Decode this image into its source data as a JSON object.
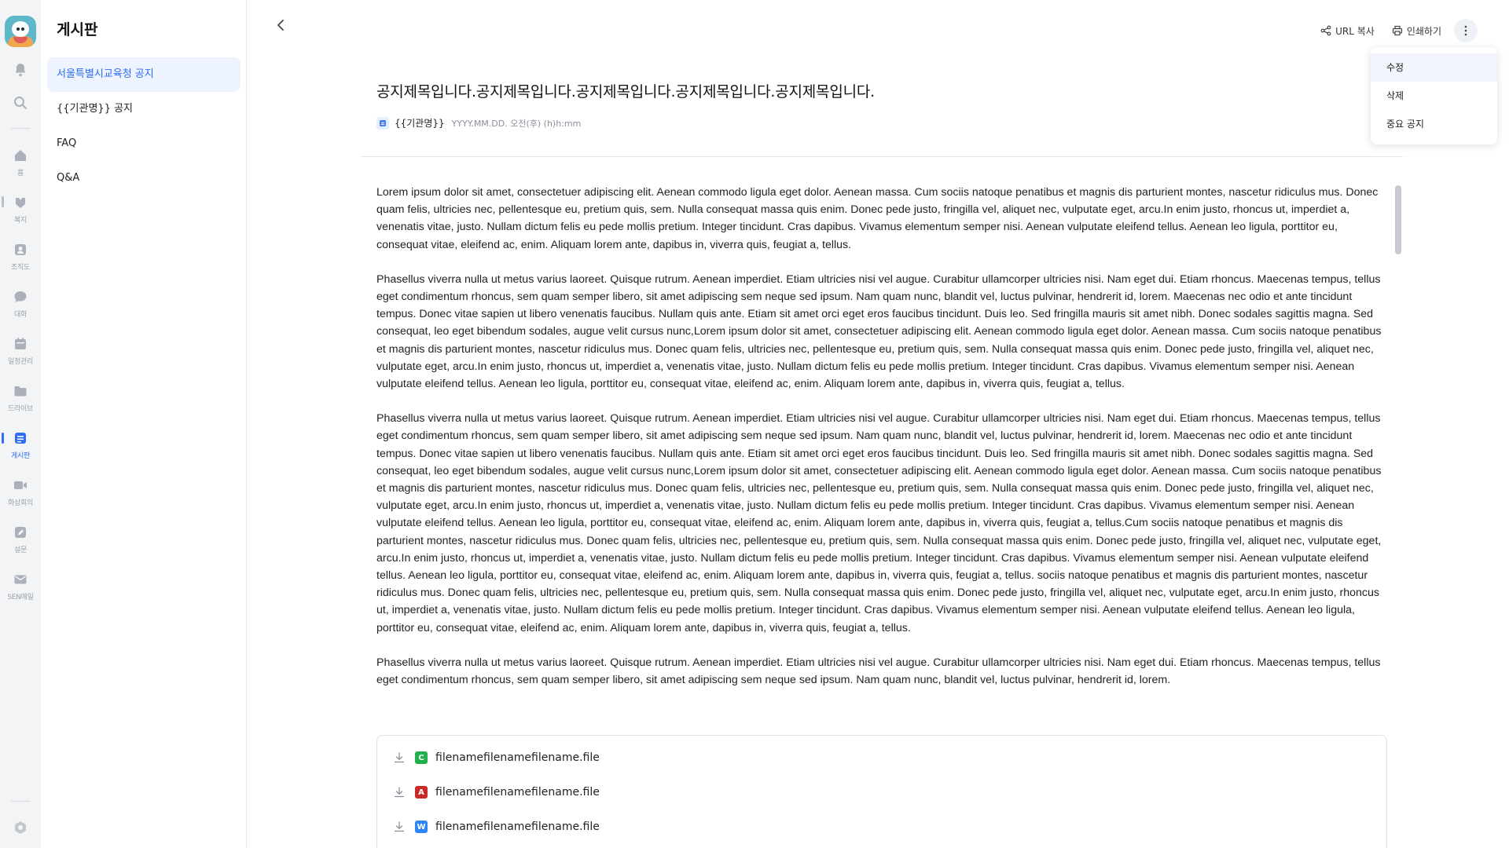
{
  "rail": {
    "items": [
      {
        "icon": "bell-icon",
        "label": ""
      },
      {
        "icon": "search-icon",
        "label": ""
      },
      {
        "icon": "home-icon",
        "label": "홈"
      },
      {
        "icon": "welfare-icon",
        "label": "복지"
      },
      {
        "icon": "org-chart-icon",
        "label": "조직도"
      },
      {
        "icon": "chat-icon",
        "label": "대화"
      },
      {
        "icon": "calendar-icon",
        "label": "일정관리"
      },
      {
        "icon": "folder-icon",
        "label": "드라이브"
      },
      {
        "icon": "board-icon",
        "label": "게시판"
      },
      {
        "icon": "video-icon",
        "label": "화상회의"
      },
      {
        "icon": "survey-icon",
        "label": "설문"
      },
      {
        "icon": "mail-icon",
        "label": "SEN메일"
      }
    ],
    "active_label": "게시판",
    "accent_color": "#2f6df6"
  },
  "sidebar": {
    "title": "게시판",
    "items": [
      {
        "label": "서울특별시교육청 공지",
        "active": true
      },
      {
        "label": "{{기관명}} 공지",
        "active": false
      },
      {
        "label": "FAQ",
        "active": false
      },
      {
        "label": "Q&A",
        "active": false
      }
    ]
  },
  "header": {
    "copy_url_label": "URL 복사",
    "print_label": "인쇄하기"
  },
  "menu": {
    "items": [
      {
        "label": "수정"
      },
      {
        "label": "삭제"
      },
      {
        "label": "중요 공지"
      }
    ]
  },
  "post": {
    "title": "공지제목입니다.공지제목입니다.공지제목입니다.공지제목입니다.공지제목입니다.",
    "org": "{{기관명}}",
    "date": "YYYY.MM.DD. 오전(후) (h)h:mm",
    "paragraphs": [
      "Lorem ipsum dolor sit amet, consectetuer adipiscing elit. Aenean commodo ligula eget dolor. Aenean massa. Cum sociis natoque penatibus et magnis dis parturient montes, nascetur ridiculus mus. Donec quam felis, ultricies nec, pellentesque eu, pretium quis, sem. Nulla consequat massa quis enim. Donec pede justo, fringilla vel, aliquet nec, vulputate eget, arcu.In enim justo, rhoncus ut, imperdiet a, venenatis vitae, justo. Nullam dictum felis eu pede mollis pretium. Integer tincidunt. Cras dapibus. Vivamus elementum semper nisi. Aenean vulputate eleifend tellus. Aenean leo ligula, porttitor eu, consequat vitae, eleifend ac, enim. Aliquam lorem ante, dapibus in, viverra quis, feugiat a, tellus.",
      "Phasellus viverra nulla ut metus varius laoreet. Quisque rutrum. Aenean imperdiet. Etiam ultricies nisi vel augue. Curabitur ullamcorper ultricies nisi. Nam eget dui. Etiam rhoncus. Maecenas tempus, tellus eget condimentum rhoncus, sem quam semper libero, sit amet adipiscing sem neque sed ipsum. Nam quam nunc, blandit vel, luctus pulvinar, hendrerit id, lorem. Maecenas nec odio et ante tincidunt tempus. Donec vitae sapien ut libero venenatis faucibus. Nullam quis ante. Etiam sit amet orci eget eros faucibus tincidunt. Duis leo. Sed fringilla mauris sit amet nibh. Donec sodales sagittis magna. Sed consequat, leo eget bibendum sodales, augue velit cursus nunc,Lorem ipsum dolor sit amet, consectetuer adipiscing elit. Aenean commodo ligula eget dolor. Aenean massa. Cum sociis natoque penatibus et magnis dis parturient montes, nascetur ridiculus mus. Donec quam felis, ultricies nec, pellentesque eu, pretium quis, sem. Nulla consequat massa quis enim. Donec pede justo, fringilla vel, aliquet nec, vulputate eget, arcu.In enim justo, rhoncus ut, imperdiet a, venenatis vitae, justo. Nullam dictum felis eu pede mollis pretium. Integer tincidunt. Cras dapibus. Vivamus elementum semper nisi. Aenean vulputate eleifend tellus. Aenean leo ligula, porttitor eu, consequat vitae, eleifend ac, enim. Aliquam lorem ante, dapibus in, viverra quis, feugiat a, tellus.",
      "Phasellus viverra nulla ut metus varius laoreet. Quisque rutrum. Aenean imperdiet. Etiam ultricies nisi vel augue. Curabitur ullamcorper ultricies nisi. Nam eget dui. Etiam rhoncus. Maecenas tempus, tellus eget condimentum rhoncus, sem quam semper libero, sit amet adipiscing sem neque sed ipsum. Nam quam nunc, blandit vel, luctus pulvinar, hendrerit id, lorem. Maecenas nec odio et ante tincidunt tempus. Donec vitae sapien ut libero venenatis faucibus. Nullam quis ante. Etiam sit amet orci eget eros faucibus tincidunt. Duis leo. Sed fringilla mauris sit amet nibh. Donec sodales sagittis magna. Sed consequat, leo eget bibendum sodales, augue velit cursus nunc,Lorem ipsum dolor sit amet, consectetuer adipiscing elit. Aenean commodo ligula eget dolor. Aenean massa. Cum sociis natoque penatibus et magnis dis parturient montes, nascetur ridiculus mus. Donec quam felis, ultricies nec, pellentesque eu, pretium quis, sem. Nulla consequat massa quis enim. Donec pede justo, fringilla vel, aliquet nec, vulputate eget, arcu.In enim justo, rhoncus ut, imperdiet a, venenatis vitae, justo. Nullam dictum felis eu pede mollis pretium. Integer tincidunt. Cras dapibus. Vivamus elementum semper nisi. Aenean vulputate eleifend tellus. Aenean leo ligula, porttitor eu, consequat vitae, eleifend ac, enim. Aliquam lorem ante, dapibus in, viverra quis, feugiat a, tellus.Cum sociis natoque penatibus et magnis dis parturient montes, nascetur ridiculus mus. Donec quam felis, ultricies nec, pellentesque eu, pretium quis, sem. Nulla consequat massa quis enim. Donec pede justo, fringilla vel, aliquet nec, vulputate eget, arcu.In enim justo, rhoncus ut, imperdiet a, venenatis vitae, justo. Nullam dictum felis eu pede mollis pretium. Integer tincidunt. Cras dapibus. Vivamus elementum semper nisi. Aenean vulputate eleifend tellus. Aenean leo ligula, porttitor eu, consequat vitae, eleifend ac, enim. Aliquam lorem ante, dapibus in, viverra quis, feugiat a, tellus. sociis natoque penatibus et magnis dis parturient montes, nascetur ridiculus mus. Donec quam felis, ultricies nec, pellentesque eu, pretium quis, sem. Nulla consequat massa quis enim. Donec pede justo, fringilla vel, aliquet nec, vulputate eget, arcu.In enim justo, rhoncus ut, imperdiet a, venenatis vitae, justo. Nullam dictum felis eu pede mollis pretium. Integer tincidunt. Cras dapibus. Vivamus elementum semper nisi. Aenean vulputate eleifend tellus. Aenean leo ligula, porttitor eu, consequat vitae, eleifend ac, enim. Aliquam lorem ante, dapibus in, viverra quis, feugiat a, tellus.",
      "Phasellus viverra nulla ut metus varius laoreet. Quisque rutrum. Aenean imperdiet. Etiam ultricies nisi vel augue. Curabitur ullamcorper ultricies nisi. Nam eget dui. Etiam rhoncus. Maecenas tempus, tellus eget condimentum rhoncus, sem quam semper libero, sit amet adipiscing sem neque sed ipsum. Nam quam nunc, blandit vel, luctus pulvinar, hendrerit id, lorem."
    ]
  },
  "attachments": [
    {
      "name": "filenamefilenamefilename.file",
      "type_icon": "spreadsheet-file-icon",
      "color": "#21b14c",
      "glyph": "C"
    },
    {
      "name": "filenamefilenamefilename.file",
      "type_icon": "pdf-file-icon",
      "color": "#c92a2a",
      "glyph": "A"
    },
    {
      "name": "filenamefilenamefilename.file",
      "type_icon": "word-file-icon",
      "color": "#2f86f6",
      "glyph": "W"
    }
  ]
}
